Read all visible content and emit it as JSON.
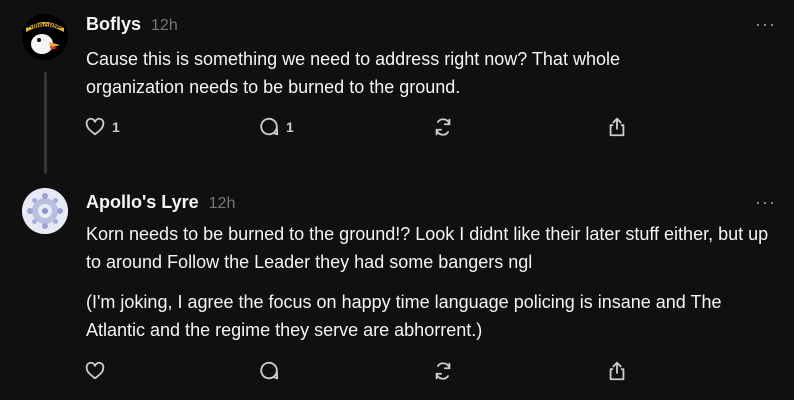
{
  "posts": [
    {
      "username": "Boflys",
      "time": "12h",
      "more_label": "···",
      "avatar_text": "AIRBORNE",
      "avatar_icon": "airborne-eagle-icon",
      "text_lines": [
        "Cause this is something we need to address right now? That whole organization needs to be burned to the ground."
      ],
      "likes": "1",
      "replies": "1"
    },
    {
      "username": "Apollo's Lyre",
      "time": "12h",
      "more_label": "···",
      "avatar_icon": "fractal-pattern-icon",
      "paragraph1": "Korn needs to be burned to the ground!? Look I didnt like their later stuff either, but up to around Follow the Leader they had some bangers ngl",
      "paragraph2": "(I'm joking, I agree the focus on happy time language policing is insane and The Atlantic and the regime they serve are abhorrent.)",
      "likes": "",
      "replies": ""
    }
  ],
  "colors": {
    "background": "#101010",
    "text": "#f3f5f7",
    "muted": "#777777",
    "thread_line": "#333638"
  }
}
